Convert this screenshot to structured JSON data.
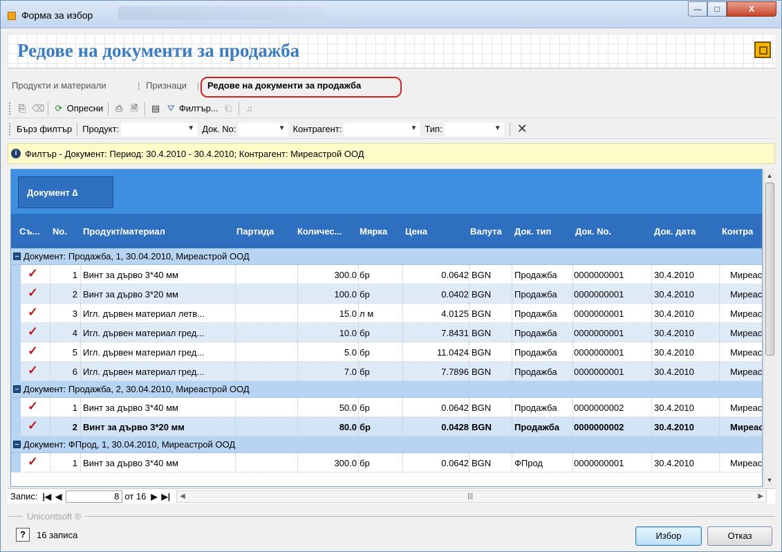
{
  "window": {
    "title": "Форма за избор",
    "controls": {
      "minimize": "—",
      "maximize": "□",
      "close": "X"
    }
  },
  "header": {
    "page_title": "Редове на документи за продажба"
  },
  "tabs": [
    {
      "label": "Продукти и материали",
      "active": false
    },
    {
      "label": "|",
      "active": false
    },
    {
      "label": "Признаци",
      "active": false
    },
    {
      "label": "|",
      "active": false
    },
    {
      "label": "Редове на документи за продажба",
      "active": true
    }
  ],
  "toolbar1": {
    "refresh_label": "Опресни",
    "filter_label": "Филтър..."
  },
  "toolbar2": {
    "quick_filter_label": "Бърз филтър",
    "product_label": "Продукт:",
    "doc_no_label": "Док. No:",
    "counterparty_label": "Контрагент:",
    "type_label": "Тип:"
  },
  "filter_info": "Филтър - Документ: Период: 30.4.2010 - 30.4.2010; Контрагент: Миреастрой ООД",
  "grid": {
    "group_chip": "Документ ∆",
    "columns": [
      "Съ...",
      "No.",
      "Продукт/материал",
      "Партида",
      "Количес...",
      "Мярка",
      "Цена",
      "Валута",
      "Док. тип",
      "Док. No.",
      "Док. дата",
      "Контра"
    ],
    "groups": [
      {
        "label": "Документ: Продажба, 1, 30.04.2010, Миреастрой ООД",
        "rows": [
          {
            "no": "1",
            "product": "Винт за дърво 3*40 мм",
            "qty": "300.0",
            "unit": "бр",
            "price": "0.0642",
            "currency": "BGN",
            "doc_type": "Продажба",
            "doc_no": "0000000001",
            "doc_date": "30.4.2010",
            "counterparty": "Миреастрой ООД"
          },
          {
            "no": "2",
            "product": "Винт за дърво 3*20 мм",
            "qty": "100.0",
            "unit": "бр",
            "price": "0.0402",
            "currency": "BGN",
            "doc_type": "Продажба",
            "doc_no": "0000000001",
            "doc_date": "30.4.2010",
            "counterparty": "Миреастрой ООД"
          },
          {
            "no": "3",
            "product": "Игл. дървен материал летв...",
            "qty": "15.0",
            "unit": "л м",
            "price": "4.0125",
            "currency": "BGN",
            "doc_type": "Продажба",
            "doc_no": "0000000001",
            "doc_date": "30.4.2010",
            "counterparty": "Миреастрой ООД"
          },
          {
            "no": "4",
            "product": "Игл. дървен материал гред...",
            "qty": "10.0",
            "unit": "бр",
            "price": "7.8431",
            "currency": "BGN",
            "doc_type": "Продажба",
            "doc_no": "0000000001",
            "doc_date": "30.4.2010",
            "counterparty": "Миреастрой ООД"
          },
          {
            "no": "5",
            "product": "Игл. дървен материал гред...",
            "qty": "5.0",
            "unit": "бр",
            "price": "11.0424",
            "currency": "BGN",
            "doc_type": "Продажба",
            "doc_no": "0000000001",
            "doc_date": "30.4.2010",
            "counterparty": "Миреастрой ООД"
          },
          {
            "no": "6",
            "product": "Игл. дървен материал гред...",
            "qty": "7.0",
            "unit": "бр",
            "price": "7.7896",
            "currency": "BGN",
            "doc_type": "Продажба",
            "doc_no": "0000000001",
            "doc_date": "30.4.2010",
            "counterparty": "Миреастрой ООД"
          }
        ]
      },
      {
        "label": "Документ: Продажба, 2, 30.04.2010, Миреастрой ООД",
        "rows": [
          {
            "no": "1",
            "product": "Винт за дърво 3*40 мм",
            "qty": "50.0",
            "unit": "бр",
            "price": "0.0642",
            "currency": "BGN",
            "doc_type": "Продажба",
            "doc_no": "0000000002",
            "doc_date": "30.4.2010",
            "counterparty": "Миреастрой ООД"
          },
          {
            "no": "2",
            "product": "Винт за дърво 3*20 мм",
            "qty": "80.0",
            "unit": "бр",
            "price": "0.0428",
            "currency": "BGN",
            "doc_type": "Продажба",
            "doc_no": "0000000002",
            "doc_date": "30.4.2010",
            "counterparty": "Миреастрой ООД",
            "selected": true
          }
        ]
      },
      {
        "label": "Документ: ФПрод, 1, 30.04.2010, Миреастрой ООД",
        "rows": [
          {
            "no": "1",
            "product": "Винт за дърво 3*40 мм",
            "qty": "300.0",
            "unit": "бр",
            "price": "0.0642",
            "currency": "BGN",
            "doc_type": "ФПрод",
            "doc_no": "0000000001",
            "doc_date": "30.4.2010",
            "counterparty": "Миреастрой ООД"
          }
        ]
      }
    ]
  },
  "navigator": {
    "label": "Запис:",
    "current": "8",
    "of_label": "от 16"
  },
  "brand": "Unicontsoft ®",
  "status": {
    "records": "16 записа"
  },
  "buttons": {
    "ok": "Избор",
    "cancel": "Отказ"
  }
}
